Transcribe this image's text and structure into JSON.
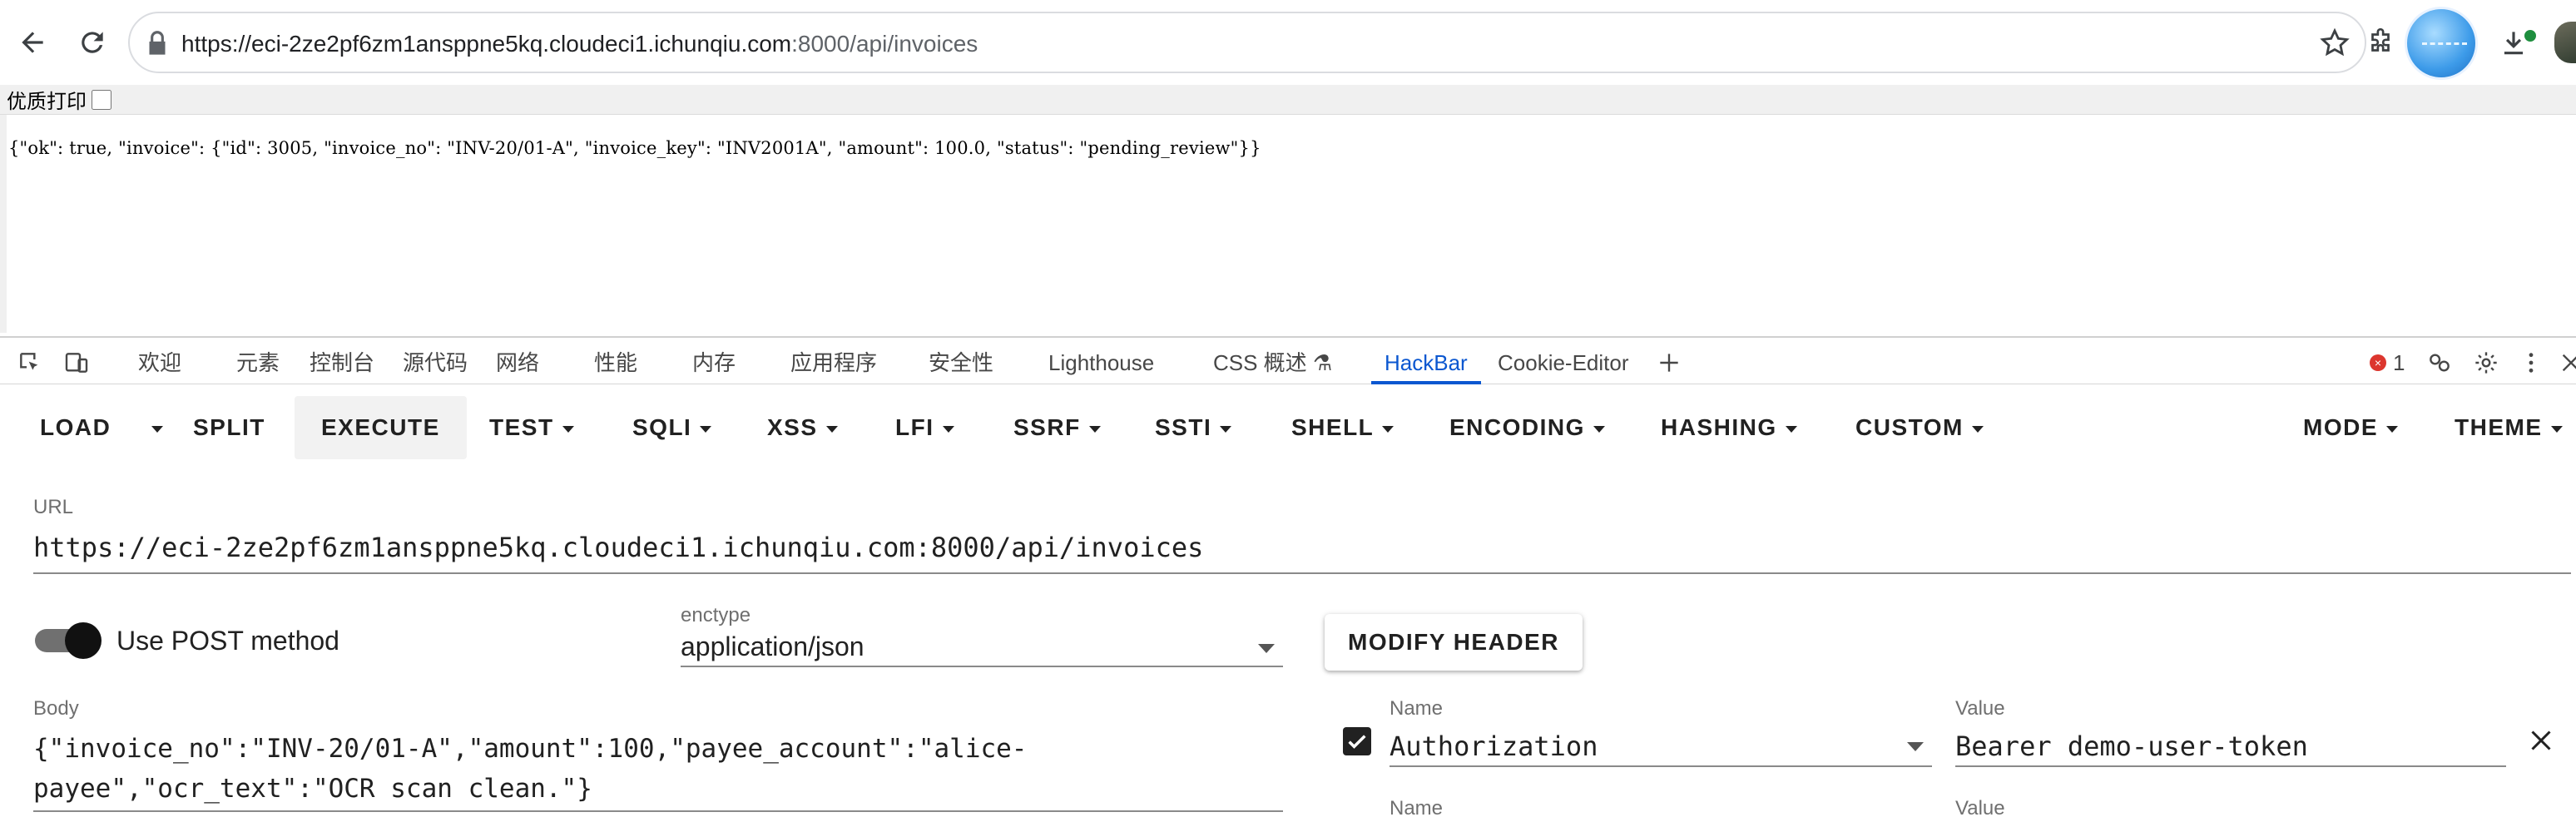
{
  "browser": {
    "url_host": "https://eci-2ze2pf6zm1ansppne5kq.cloudeci1.ichunqiu.com",
    "url_path": ":8000/api/invoices"
  },
  "page": {
    "print_label": "优质打印",
    "json_text": "{\"ok\": true, \"invoice\": {\"id\": 3005, \"invoice_no\": \"INV-20/01-A\", \"invoice_key\": \"INV2001A\", \"amount\": 100.0, \"status\": \"pending_review\"}}"
  },
  "devtools": {
    "tabs": [
      "欢迎",
      "元素",
      "控制台",
      "源代码",
      "网络",
      "性能",
      "内存",
      "应用程序",
      "安全性",
      "Lighthouse",
      "CSS 概述 ⚗",
      "HackBar",
      "Cookie-Editor"
    ],
    "active_tab": "HackBar",
    "error_count": "1",
    "error_badge": "×",
    "accent_color": "#0b57d0"
  },
  "hackbar": {
    "menu": {
      "load": "LOAD",
      "split": "SPLIT",
      "execute": "EXECUTE",
      "test": "TEST",
      "sqli": "SQLI",
      "xss": "XSS",
      "lfi": "LFI",
      "ssrf": "SSRF",
      "ssti": "SSTI",
      "shell": "SHELL",
      "encoding": "ENCODING",
      "hashing": "HASHING",
      "custom": "CUSTOM",
      "mode": "MODE",
      "theme": "THEME"
    },
    "url_label": "URL",
    "url_value": "https://eci-2ze2pf6zm1ansppne5kq.cloudeci1.ichunqiu.com:8000/api/invoices",
    "use_post_label": "Use POST method",
    "use_post_enabled": true,
    "enctype_label": "enctype",
    "enctype_value": "application/json",
    "modify_header_label": "MODIFY HEADER",
    "body_label": "Body",
    "body_value": "{\"invoice_no\":\"INV-20/01-A\",\"amount\":100,\"payee_account\":\"alice-\npayee\",\"ocr_text\":\"OCR scan clean.\"}",
    "headers": [
      {
        "enabled": true,
        "name_label": "Name",
        "name": "Authorization",
        "value_label": "Value",
        "value": "Bearer demo-user-token"
      },
      {
        "name_label": "Name",
        "value_label": "Value"
      }
    ]
  }
}
